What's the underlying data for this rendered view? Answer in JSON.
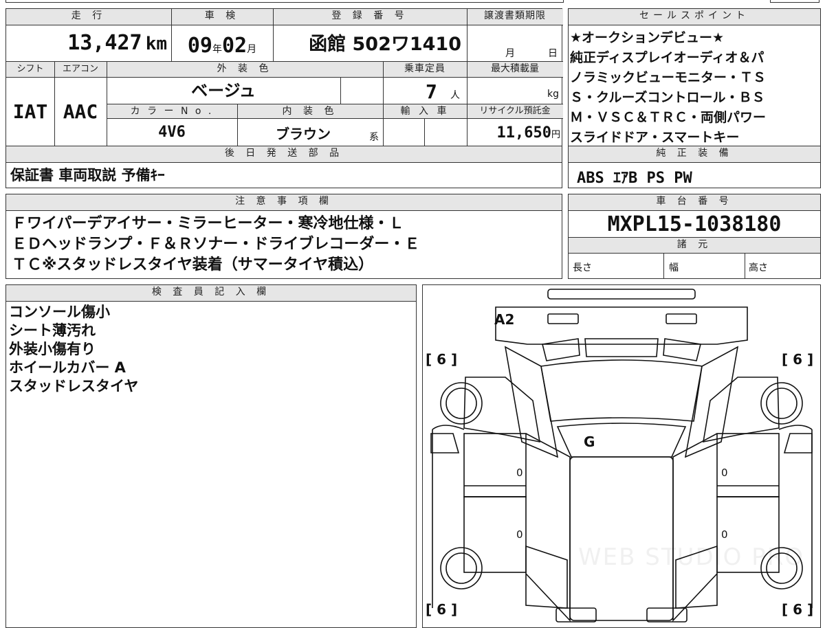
{
  "vehicle": {
    "mileage_label": "走 行",
    "mileage_value": "13,427",
    "mileage_unit": "km",
    "inspection_label": "車 検",
    "inspection_year": "09",
    "inspection_year_unit": "年",
    "inspection_month": "02",
    "inspection_month_unit": "月",
    "registration_label": "登 録 番 号",
    "registration_value": "函館 502ワ1410",
    "transfer_label": "譲渡書類期限",
    "transfer_month_unit": "月",
    "transfer_day_unit": "日",
    "shift_label": "シフト",
    "shift_value": "IAT",
    "ac_label": "エアコン",
    "ac_value": "AAC",
    "exterior_color_label": "外 装 色",
    "exterior_color_value": "ベージュ",
    "capacity_label": "乗車定員",
    "capacity_value": "7",
    "capacity_unit": "人",
    "max_load_label": "最大積載量",
    "max_load_unit": "kg",
    "color_no_label": "カ ラ ー N o .",
    "color_no_value": "4V6",
    "interior_color_label": "内 装 色",
    "interior_color_value": "ブラウン",
    "interior_color_suffix": "系",
    "import_label": "輸 入 車",
    "recycle_label": "リサイクル預託金",
    "recycle_value": "11,650",
    "recycle_unit": "円"
  },
  "sales_points": {
    "title": "セールスポイント",
    "lines": [
      "★オークションデビュー★",
      "純正ディスプレイオーディオ＆パ",
      "ノラミックビューモニター・ＴＳ",
      "Ｓ・クルーズコントロール・ＢＳ",
      "Ｍ・ＶＳＣ＆ＴＲＣ・両側パワー",
      "スライドドア・スマートキー"
    ]
  },
  "later_parts": {
    "title": "後 日 発 送 部 品",
    "value": "保証書 車両取説 予備ｷｰ"
  },
  "standard_equipment": {
    "title": "純 正 装 備",
    "value": "ABS ｴｱB PS PW"
  },
  "notes": {
    "title": "注 意 事 項 欄",
    "lines": [
      "Ｆワイパーデアイサー・ミラーヒーター・寒冷地仕様・Ｌ",
      "ＥＤヘッドランプ・Ｆ＆Ｒソナー・ドライブレコーダー・Ｅ",
      "ＴＣ※スタッドレスタイヤ装着（サマータイヤ積込）"
    ]
  },
  "chassis": {
    "title": "車 台 番 号",
    "value": "MXPL15-1038180",
    "specs_title": "諸 元",
    "length_label": "長さ",
    "width_label": "幅",
    "height_label": "高さ"
  },
  "inspector": {
    "title": "検 査 員 記 入 欄",
    "lines": [
      "コンソール傷小",
      "シート薄汚れ",
      "外装小傷有り",
      "ホイールカバー A",
      "スタッドレスタイヤ"
    ]
  },
  "diagram": {
    "front_mark": "A2",
    "glass_mark": "G",
    "tread_fl": "[ 6 ]",
    "tread_fr": "[ 6 ]",
    "tread_rl": "[ 6 ]",
    "tread_rr": "[ 6 ]",
    "door_fl": "0",
    "door_rl": "0",
    "door_fr": "0",
    "door_rr": "0",
    "watermark": "WEB STUDIO PRO"
  }
}
